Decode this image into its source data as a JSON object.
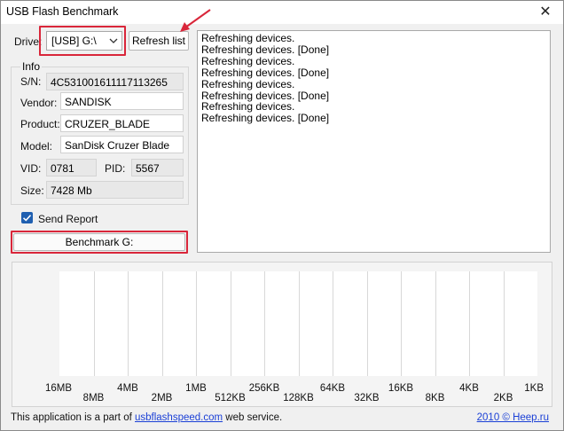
{
  "window": {
    "title": "USB Flash Benchmark",
    "close_glyph": "✕"
  },
  "drive": {
    "label": "Drive:",
    "selected": "[USB] G:\\",
    "refresh_label": "Refresh list"
  },
  "info": {
    "legend": "Info",
    "sn_label": "S/N:",
    "sn_value": "4C531001611117113265",
    "vendor_label": "Vendor:",
    "vendor_value": "SANDISK",
    "product_label": "Product:",
    "product_value": "CRUZER_BLADE",
    "model_label": "Model:",
    "model_value": "SanDisk Cruzer Blade",
    "vid_label": "VID:",
    "vid_value": "0781",
    "pid_label": "PID:",
    "pid_value": "5567",
    "size_label": "Size:",
    "size_value": "7428 Mb"
  },
  "send_report": {
    "label": "Send Report",
    "checked": true
  },
  "benchmark_button": "Benchmark G:",
  "log": [
    "Refreshing devices.",
    "Refreshing devices. [Done]",
    "Refreshing devices.",
    "Refreshing devices. [Done]",
    "Refreshing devices.",
    "Refreshing devices. [Done]",
    "Refreshing devices.",
    "Refreshing devices. [Done]"
  ],
  "chart_data": {
    "type": "bar",
    "categories": [
      "16MB",
      "8MB",
      "4MB",
      "2MB",
      "1MB",
      "512KB",
      "256KB",
      "128KB",
      "64KB",
      "32KB",
      "16KB",
      "8KB",
      "4KB",
      "2KB",
      "1KB"
    ],
    "values": [],
    "title": "",
    "xlabel": "",
    "ylabel": "",
    "grid": true
  },
  "footer": {
    "prefix": "This application is a part of ",
    "link": "usbflashspeed.com",
    "suffix": " web service.",
    "copyright": "2010 © Heep.ru"
  },
  "colors": {
    "highlight": "#d9263a",
    "link": "#1a3fd6",
    "checkbox": "#1f5fb0"
  }
}
